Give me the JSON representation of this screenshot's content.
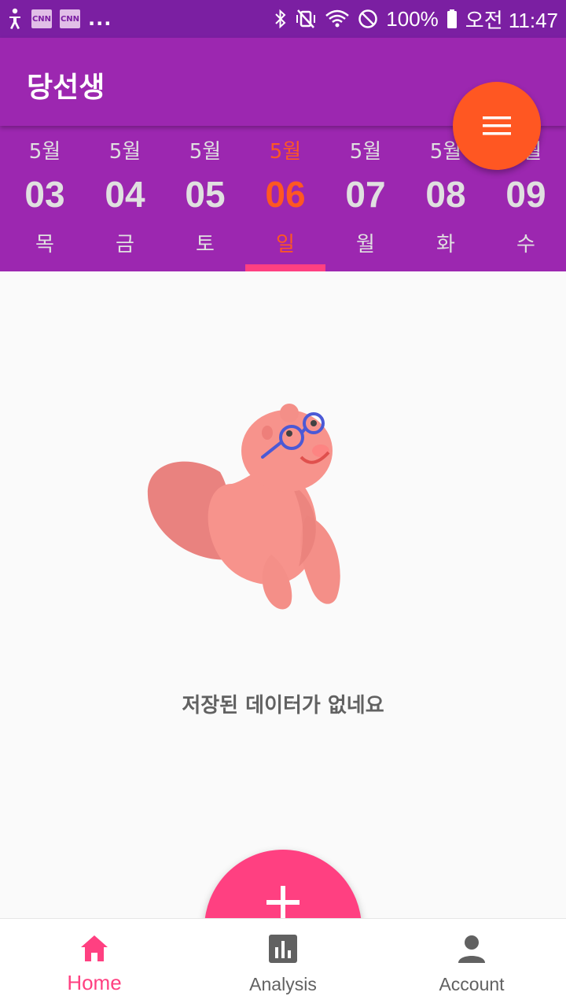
{
  "status_bar": {
    "left_icons": [
      "accessibility-icon",
      "cnn-icon",
      "cnn-icon"
    ],
    "overflow": "...",
    "battery": "100%",
    "time": "오전 11:47"
  },
  "app_bar": {
    "title": "당선생",
    "menu_icon": "hamburger-icon"
  },
  "dates": [
    {
      "month": "5월",
      "day": "03",
      "weekday": "목",
      "selected": false
    },
    {
      "month": "5월",
      "day": "04",
      "weekday": "금",
      "selected": false
    },
    {
      "month": "5월",
      "day": "05",
      "weekday": "토",
      "selected": false
    },
    {
      "month": "5월",
      "day": "06",
      "weekday": "일",
      "selected": true
    },
    {
      "month": "5월",
      "day": "07",
      "weekday": "월",
      "selected": false
    },
    {
      "month": "5월",
      "day": "08",
      "weekday": "화",
      "selected": false
    },
    {
      "month": "5월",
      "day": "09",
      "weekday": "수",
      "selected": false
    }
  ],
  "empty_state": {
    "message": "저장된 데이터가 없네요",
    "illustration": "squirrel-with-glasses"
  },
  "add_button": {
    "icon": "plus-icon"
  },
  "bottom_nav": [
    {
      "label": "Home",
      "icon": "home-icon",
      "active": true
    },
    {
      "label": "Analysis",
      "icon": "bar-chart-icon",
      "active": false
    },
    {
      "label": "Account",
      "icon": "person-icon",
      "active": false
    }
  ],
  "colors": {
    "status_bar": "#7b1fa2",
    "primary": "#9c27b0",
    "accent_orange": "#ff5722",
    "accent_pink": "#ff4081",
    "date_text": "#e0e0e0"
  }
}
